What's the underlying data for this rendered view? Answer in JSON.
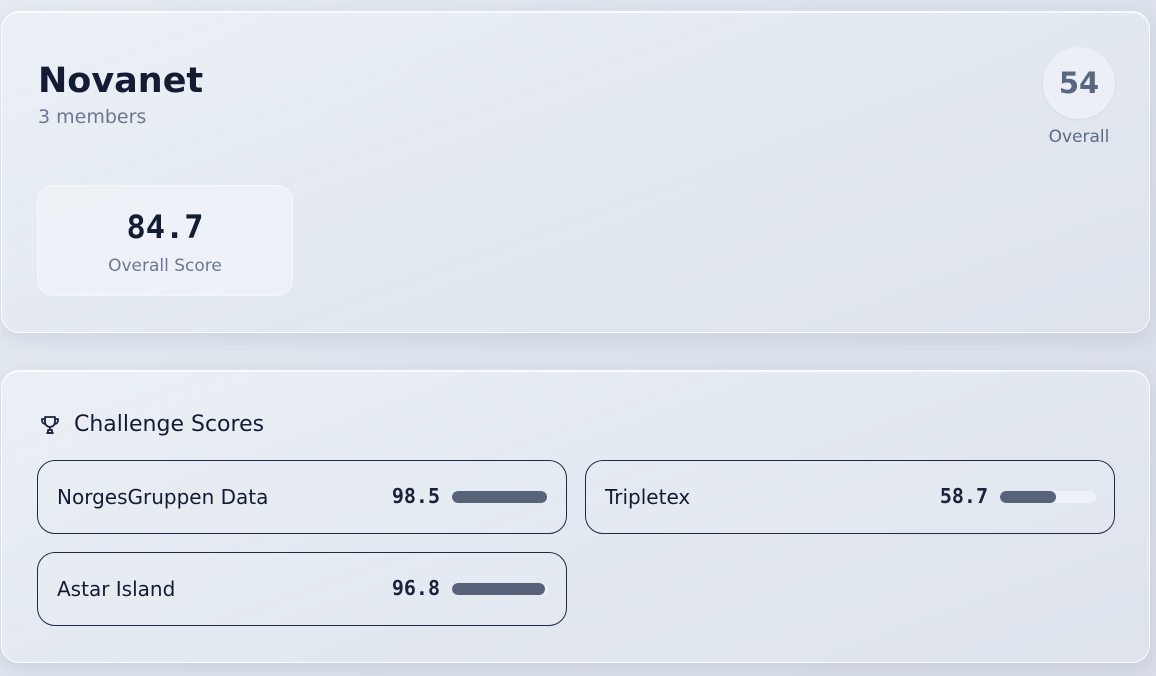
{
  "team": {
    "name": "Novanet",
    "members": "3 members",
    "rank": "54",
    "rank_label": "Overall",
    "score": "84.7",
    "score_label": "Overall Score"
  },
  "challenges": {
    "title": "Challenge Scores",
    "icon": "trophy-icon",
    "items": [
      {
        "name": "NorgesGruppen Data",
        "score": "98.5",
        "progress": 0.985
      },
      {
        "name": "Tripletex",
        "score": "58.7",
        "progress": 0.587
      },
      {
        "name": "Astar Island",
        "score": "96.8",
        "progress": 0.968
      }
    ]
  },
  "colors": {
    "bar_fill": "#586278",
    "bar_track": "#eef1f6",
    "text_primary": "#131c33",
    "text_muted": "#6c7890"
  }
}
